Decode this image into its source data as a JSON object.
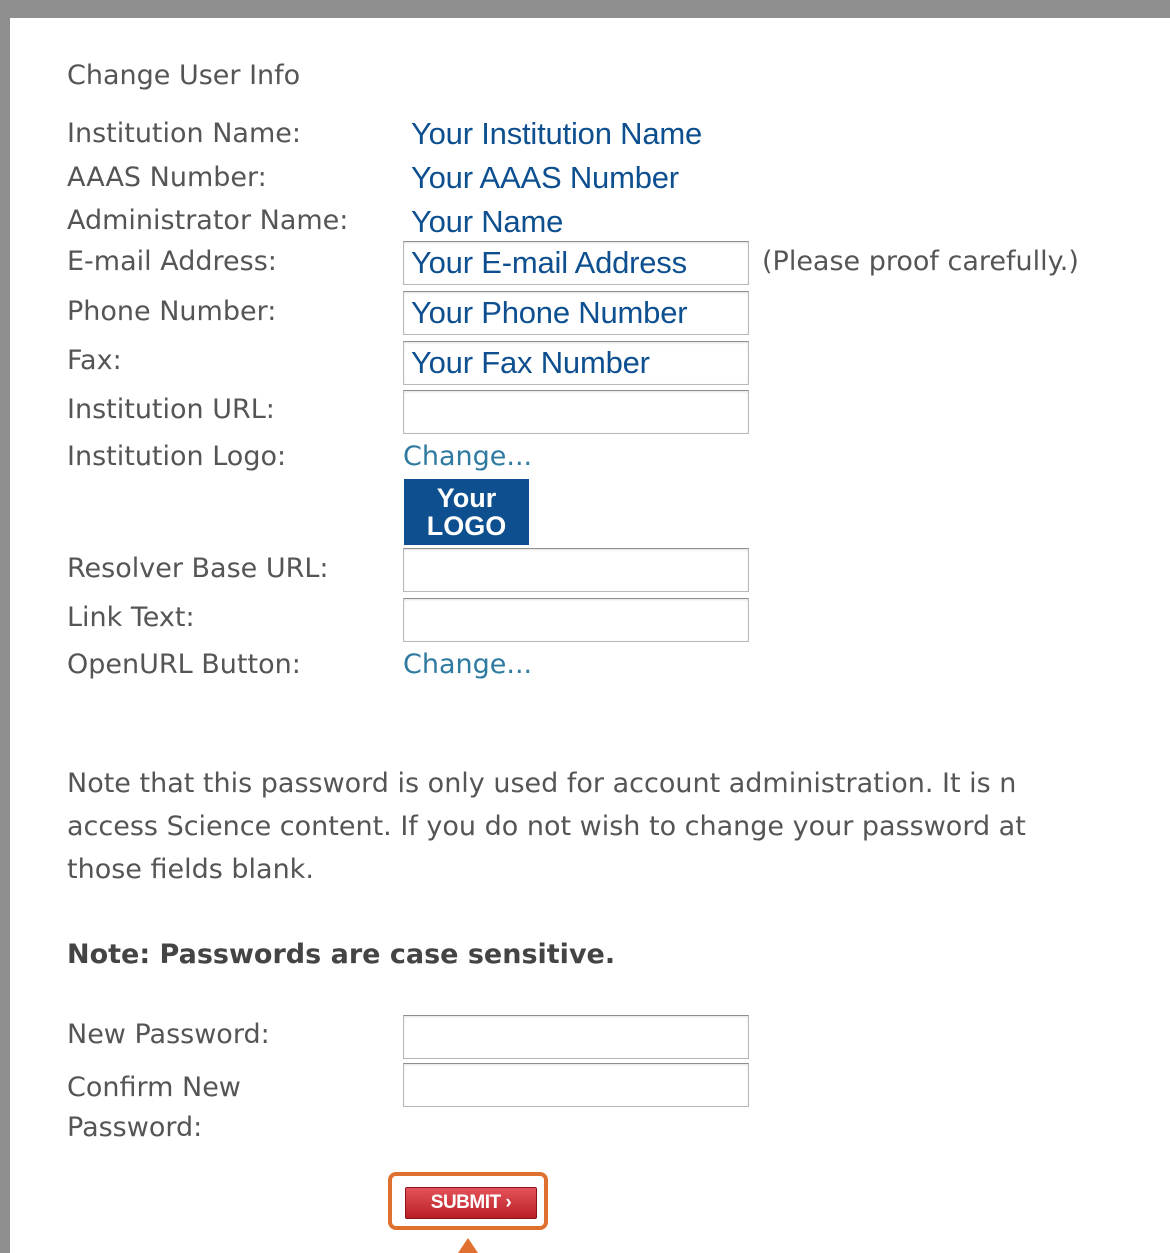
{
  "section_title": "Change User Info",
  "fields": {
    "institution_name": {
      "label": "Institution Name:",
      "value": "Your Institution Name"
    },
    "aaas_number": {
      "label": "AAAS Number:",
      "value": "Your AAAS Number"
    },
    "administrator_name": {
      "label": "Administrator Name:",
      "value": "Your Name"
    },
    "email": {
      "label": "E-mail Address:",
      "value": "Your E-mail Address",
      "hint": "(Please proof carefully.)"
    },
    "phone": {
      "label": "Phone Number:",
      "value": "Your Phone Number"
    },
    "fax": {
      "label": "Fax:",
      "value": "Your Fax Number"
    },
    "institution_url": {
      "label": "Institution URL:",
      "value": ""
    },
    "institution_logo": {
      "label": "Institution Logo:",
      "link": "Change...",
      "logo_line1": "Your",
      "logo_line2": "LOGO"
    },
    "resolver_base_url": {
      "label": "Resolver Base URL:",
      "value": ""
    },
    "link_text": {
      "label": "Link Text:",
      "value": ""
    },
    "openurl_button": {
      "label": "OpenURL Button:",
      "link": "Change..."
    }
  },
  "password_note": {
    "line1": "Note that this password is only used for account administration. It is n",
    "line2": "access Science content. If you do not wish to change your password at",
    "line3": "those fields blank.",
    "bold": "Note: Passwords are case sensitive."
  },
  "password_fields": {
    "new_password": {
      "label": "New Password:"
    },
    "confirm_line1": "Confirm New",
    "confirm_line2": "Password:"
  },
  "submit": {
    "label": "SUBMIT ›"
  },
  "colors": {
    "value_text": "#0d4f8f",
    "link": "#2f7aa0",
    "label": "#555555",
    "submit_red": "#c8262d",
    "highlight": "#e07030"
  }
}
